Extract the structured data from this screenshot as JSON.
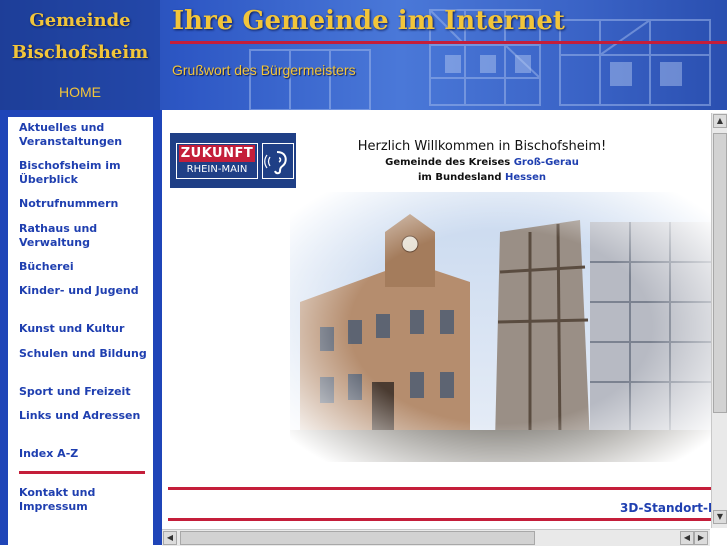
{
  "header": {
    "logo_line1": "Gemeinde",
    "logo_line2": "Bischofsheim",
    "home_label": "HOME",
    "title": "Ihre Gemeinde im Internet",
    "subtitle": "Grußwort des Bürgermeisters"
  },
  "sidebar": {
    "items": [
      {
        "label": "Aktuelles und Veranstaltungen"
      },
      {
        "label": "Bischofsheim im Überblick"
      },
      {
        "label": "Notrufnummern"
      },
      {
        "label": "Rathaus und Verwaltung"
      },
      {
        "label": "Bücherei"
      },
      {
        "label": "Kinder- und Jugend"
      },
      {
        "label": "Kunst und Kultur"
      },
      {
        "label": "Schulen und Bildung"
      },
      {
        "label": "Sport und Freizeit"
      },
      {
        "label": "Links und Adressen"
      },
      {
        "label": "Index A-Z"
      }
    ],
    "footer_item": {
      "label": "Kontakt und Impressum"
    }
  },
  "content": {
    "badge_top": "ZUKUNFT",
    "badge_bottom": "RHEIN-MAIN",
    "welcome": "Herzlich Willkommen in Bischofsheim!",
    "line1_prefix": "Gemeinde des Kreises",
    "line1_link": "Groß-Gerau",
    "line2_prefix": "im Bundesland",
    "line2_link": "Hessen",
    "standort_link": "3D-Standort-I"
  },
  "colors": {
    "brand_blue": "#1f45b8",
    "accent_gold": "#f2c53a",
    "accent_red": "#c41e3a",
    "link_blue": "#1f3fb0"
  }
}
